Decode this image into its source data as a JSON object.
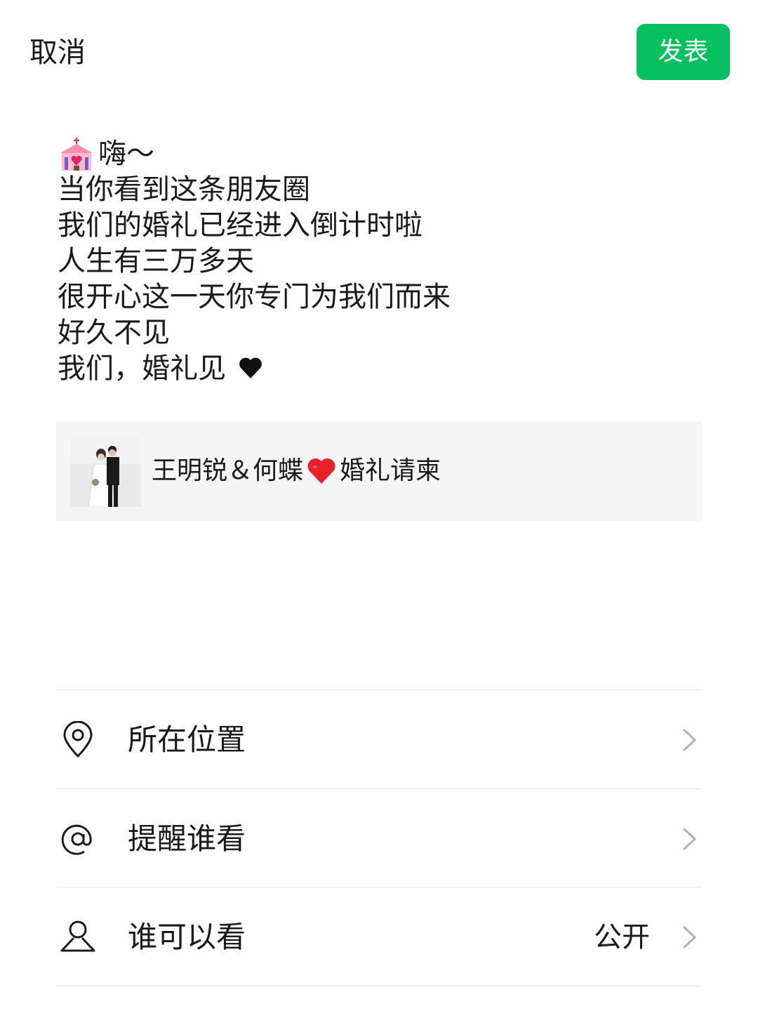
{
  "header": {
    "cancel_label": "取消",
    "publish_label": "发表",
    "publish_color": "#07c160"
  },
  "post": {
    "lines": [
      "嗨～",
      "当你看到这条朋友圈",
      "我们的婚礼已经进入倒计时啦",
      "人生有三万多天",
      "很开心这一天你专门为我们而来",
      "好久不见",
      "我们，婚礼见"
    ],
    "leading_emoji": "wedding-chapel-icon",
    "trailing_emoji": "black-heart-icon"
  },
  "link_card": {
    "title_part1": "王明锐＆何蝶",
    "title_emoji": "red-heart-icon",
    "title_part2": "婚礼请柬",
    "thumbnail": "wedding-photo-thumbnail"
  },
  "options": [
    {
      "label": "所在位置",
      "icon": "location-pin-icon",
      "value": ""
    },
    {
      "label": "提醒谁看",
      "icon": "at-sign-icon",
      "value": ""
    },
    {
      "label": "谁可以看",
      "icon": "person-icon",
      "value": "公开"
    }
  ]
}
